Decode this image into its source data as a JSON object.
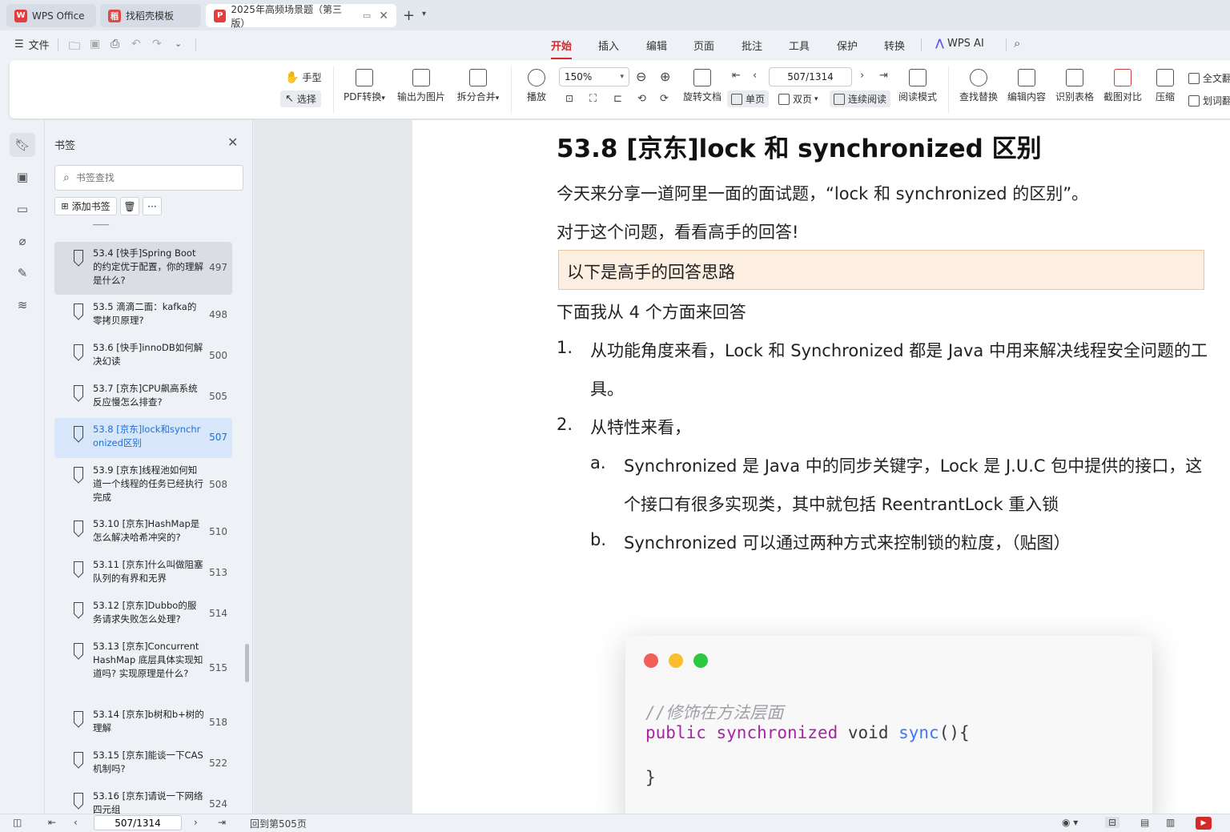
{
  "tabs": [
    {
      "label": "WPS Office"
    },
    {
      "label": "找稻壳模板"
    },
    {
      "label": "2025年高频场景题（第三版）"
    }
  ],
  "menubar": {
    "file": "文件",
    "items": [
      "开始",
      "插入",
      "编辑",
      "页面",
      "批注",
      "工具",
      "保护",
      "转换",
      "WPS AI"
    ],
    "active": "开始"
  },
  "ribbon": {
    "hand": "手型",
    "select": "选择",
    "pdf_convert": "PDF转换",
    "export_image": "输出为图片",
    "split_merge": "拆分合并",
    "play": "播放",
    "zoom": "150%",
    "rotate": "旋转文档",
    "single": "单页",
    "double": "双页",
    "continuous": "连续阅读",
    "page_value": "507/1314",
    "read_mode": "阅读模式",
    "find_replace": "查找替换",
    "edit_content": "编辑内容",
    "recognize_table": "识别表格",
    "screenshot_compare": "截图对比",
    "compress": "压缩",
    "full_text": "全文翻",
    "word_translate": "划词翻"
  },
  "panel": {
    "title": "书签",
    "search_placeholder": "书签查找",
    "add_bookmark": "添加书签",
    "more": "···",
    "bookmarks": [
      {
        "title": "53.4 [快手]Spring Boot 的约定优于配置，你的理解是什么?",
        "page": "497"
      },
      {
        "title": "53.5 滴滴二面：kafka的零拷贝原理?",
        "page": "498"
      },
      {
        "title": "53.6 [快手]innoDB如何解决幻读",
        "page": "500"
      },
      {
        "title": "53.7 [京东]CPU飙高系统反应慢怎么排查?",
        "page": "505"
      },
      {
        "title": "53.8 [京东]lock和synchronized区别",
        "page": "507"
      },
      {
        "title": "53.9 [京东]线程池如何知道一个线程的任务已经执行完成",
        "page": "508"
      },
      {
        "title": "53.10 [京东]HashMap是怎么解决哈希冲突的?",
        "page": "510"
      },
      {
        "title": "53.11 [京东]什么叫做阻塞队列的有界和无界",
        "page": "513"
      },
      {
        "title": "53.12 [京东]Dubbo的服务请求失败怎么处理?",
        "page": "514"
      },
      {
        "title": "53.13 [京东]ConcurrentHashMap 底层具体实现知道吗? 实现原理是什么?",
        "page": "515"
      },
      {
        "title": "53.14 [京东]b树和b+树的理解",
        "page": "518"
      },
      {
        "title": "53.15 [京东]能谈一下CAS机制吗?",
        "page": "522"
      },
      {
        "title": "53.16 [京东]请说一下网络四元组",
        "page": "524"
      }
    ]
  },
  "doc": {
    "heading": "53.8 [京东]lock 和 synchronized 区别",
    "intro": "今天来分享一道阿里一面的面试题，“lock 和 synchronized 的区别”。",
    "q": "对于这个问题，看看高手的回答!",
    "callout": "以下是高手的回答思路",
    "four": "下面我从 4 个方面来回答",
    "item1_num": "1.",
    "item1_a": "从功能角度来看，Lock 和 Synchronized 都是 Java 中用来解决线程安全问题的工",
    "item1_b": "具。",
    "item2_num": "2.",
    "item2": "从特性来看，",
    "suba_num": "a.",
    "suba_a": "Synchronized 是 Java 中的同步关键字，Lock 是 J.U.C 包中提供的接口，这",
    "suba_b": "个接口有很多实现类，其中就包括 ReentrantLock 重入锁",
    "subb_num": "b.",
    "subb": "Synchronized 可以通过两种方式来控制锁的粒度，（贴图）",
    "code": {
      "comment": "//修饰在方法层面",
      "kw_public": "public",
      "kw_sync": "synchronized",
      "kw_void": "void",
      "fn": "sync",
      "parens": "(){",
      "close": "}"
    }
  },
  "status": {
    "page_value": "507/1314",
    "back_text": "回到第505页"
  },
  "colors": {
    "accent": "#d52a2a",
    "link": "#1e6fd9",
    "callout_bg": "#fcefe2",
    "code_keyword": "#a626a4",
    "code_fn": "#4078f2",
    "dot_red": "#f25f58",
    "dot_yellow": "#fbbe2e",
    "dot_green": "#2bc840"
  }
}
